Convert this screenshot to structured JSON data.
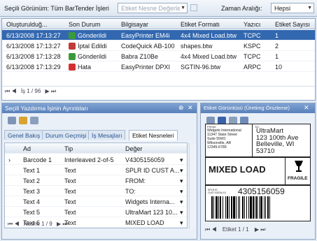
{
  "toolbar": {
    "view_label": "Seçili Görünüm: Tüm BarTender İşleri",
    "filter_placeholder": "Etiket Nesne Değerlerini Ara",
    "range_label": "Zaman Aralığı:",
    "range_value": "Hepsi"
  },
  "grid": {
    "columns": [
      "Oluşturulduğ...",
      "Son Durum",
      "Bilgisayar",
      "Etiket Formatı",
      "Yazıcı",
      "Etiket Sayısı"
    ],
    "rows": [
      {
        "created": "6/13/2008 17:13:27",
        "status": "Gönderildi",
        "status_icon": "sent-icon",
        "computer": "EasyPrinter EM4i",
        "format": "4x4 Mixed Load.btw",
        "printer": "TCPC",
        "count": "1"
      },
      {
        "created": "6/13/2008 17:13:27",
        "status": "İptal Edildi",
        "status_icon": "cancelled-icon",
        "computer": "CodeQuick AB-100",
        "format": "shapes.btw",
        "printer": "KSPC",
        "count": "2"
      },
      {
        "created": "6/13/2008 17:13:28",
        "status": "Gönderildi",
        "status_icon": "sent-icon",
        "computer": "Babra Z10Be",
        "format": "4x4 Mixed Load.btw",
        "printer": "TCPC",
        "count": "1"
      },
      {
        "created": "6/13/2008 17:13:29",
        "status": "Hata",
        "status_icon": "error-icon",
        "computer": "EasyPrinter DPXI",
        "format": "SGTIN-96.btw",
        "printer": "ARPC",
        "count": "10"
      }
    ],
    "nav_text": "İş 1 / 96"
  },
  "left_panel": {
    "title": "Seçili Yazdırma İşinin Ayrıntıları",
    "tabs": [
      "Genel Bakış",
      "Durum Geçmişi",
      "İş Mesajları",
      "Etiket Nesneleri"
    ],
    "columns": [
      "Ad",
      "Tip",
      "Değer"
    ],
    "rows": [
      {
        "name": "Barcode 1",
        "type": "Interleaved 2-of-5",
        "value": "V4305156059"
      },
      {
        "name": "Text 1",
        "type": "Text",
        "value": "SPLR ID CUST A..."
      },
      {
        "name": "Text 2",
        "type": "Text",
        "value": "FROM:"
      },
      {
        "name": "Text 3",
        "type": "Text",
        "value": "TO:"
      },
      {
        "name": "Text 4",
        "type": "Text",
        "value": "Widgets Interna..."
      },
      {
        "name": "Text 5",
        "type": "Text",
        "value": "UltraMart 123 10..."
      },
      {
        "name": "Text 6",
        "type": "Text",
        "value": "MIXED LOAD"
      }
    ],
    "nav_text": "Nesne 1 / 9"
  },
  "right_panel": {
    "title": "Etiket Görüntüsü (Üretimg Önizleme)",
    "nav_text": "Etiket 1 / 1",
    "label": {
      "from_caption": "FROM:",
      "from_lines": [
        "Widgets International",
        "11347 State Street",
        "Suite 55W1",
        "Wilsonville, AR",
        "12345-6789"
      ],
      "to_caption": "TO:",
      "to_lines": [
        "UltraMart",
        "123 100th Ave",
        "Belleville, WI",
        "53710"
      ],
      "mixed_load": "MIXED LOAD",
      "fragile": "FRAGILE",
      "splr_caption": "SPLR ID\nCUST ASGN (V)",
      "barcode_number": "4305156059"
    }
  },
  "colors": {
    "selection": "#3268b0",
    "panel_header": "#5880bb",
    "sent": "#3a9a3a",
    "error": "#d23030"
  }
}
